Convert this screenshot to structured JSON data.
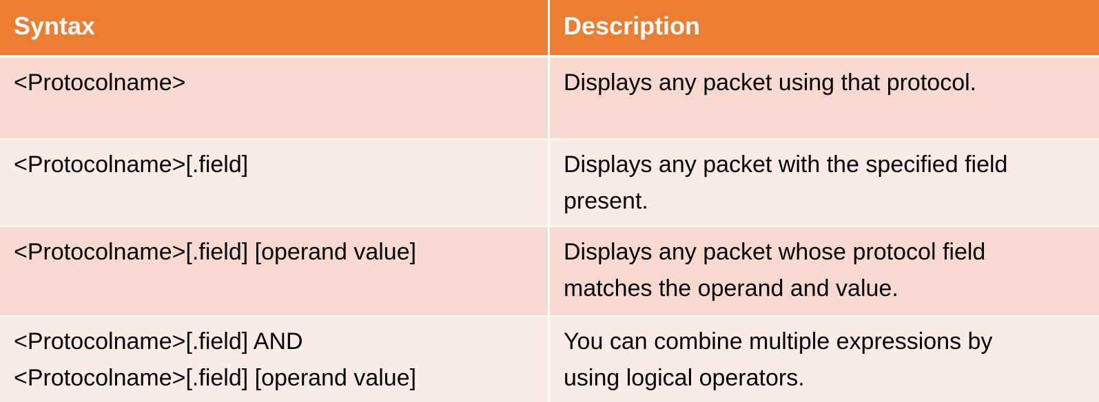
{
  "table": {
    "headers": {
      "syntax": "Syntax",
      "description": "Description"
    },
    "rows": [
      {
        "syntax": [
          "<Protocolname>"
        ],
        "description": [
          "Displays any packet using that protocol."
        ]
      },
      {
        "syntax": [
          "<Protocolname>[.field]"
        ],
        "description": [
          "Displays any packet with the specified field",
          "present."
        ]
      },
      {
        "syntax": [
          "<Protocolname>[.field] [operand value]"
        ],
        "description": [
          "Displays any packet whose protocol field",
          "matches the operand and value."
        ]
      },
      {
        "syntax": [
          "<Protocolname>[.field] AND",
          "<Protocolname>[.field] [operand value]"
        ],
        "description": [
          "You can combine multiple expressions by",
          "using logical operators."
        ]
      }
    ]
  },
  "colors": {
    "header": "#ED7D31",
    "row_dark": "#F8D9CF",
    "row_light": "#FBEBE7"
  }
}
